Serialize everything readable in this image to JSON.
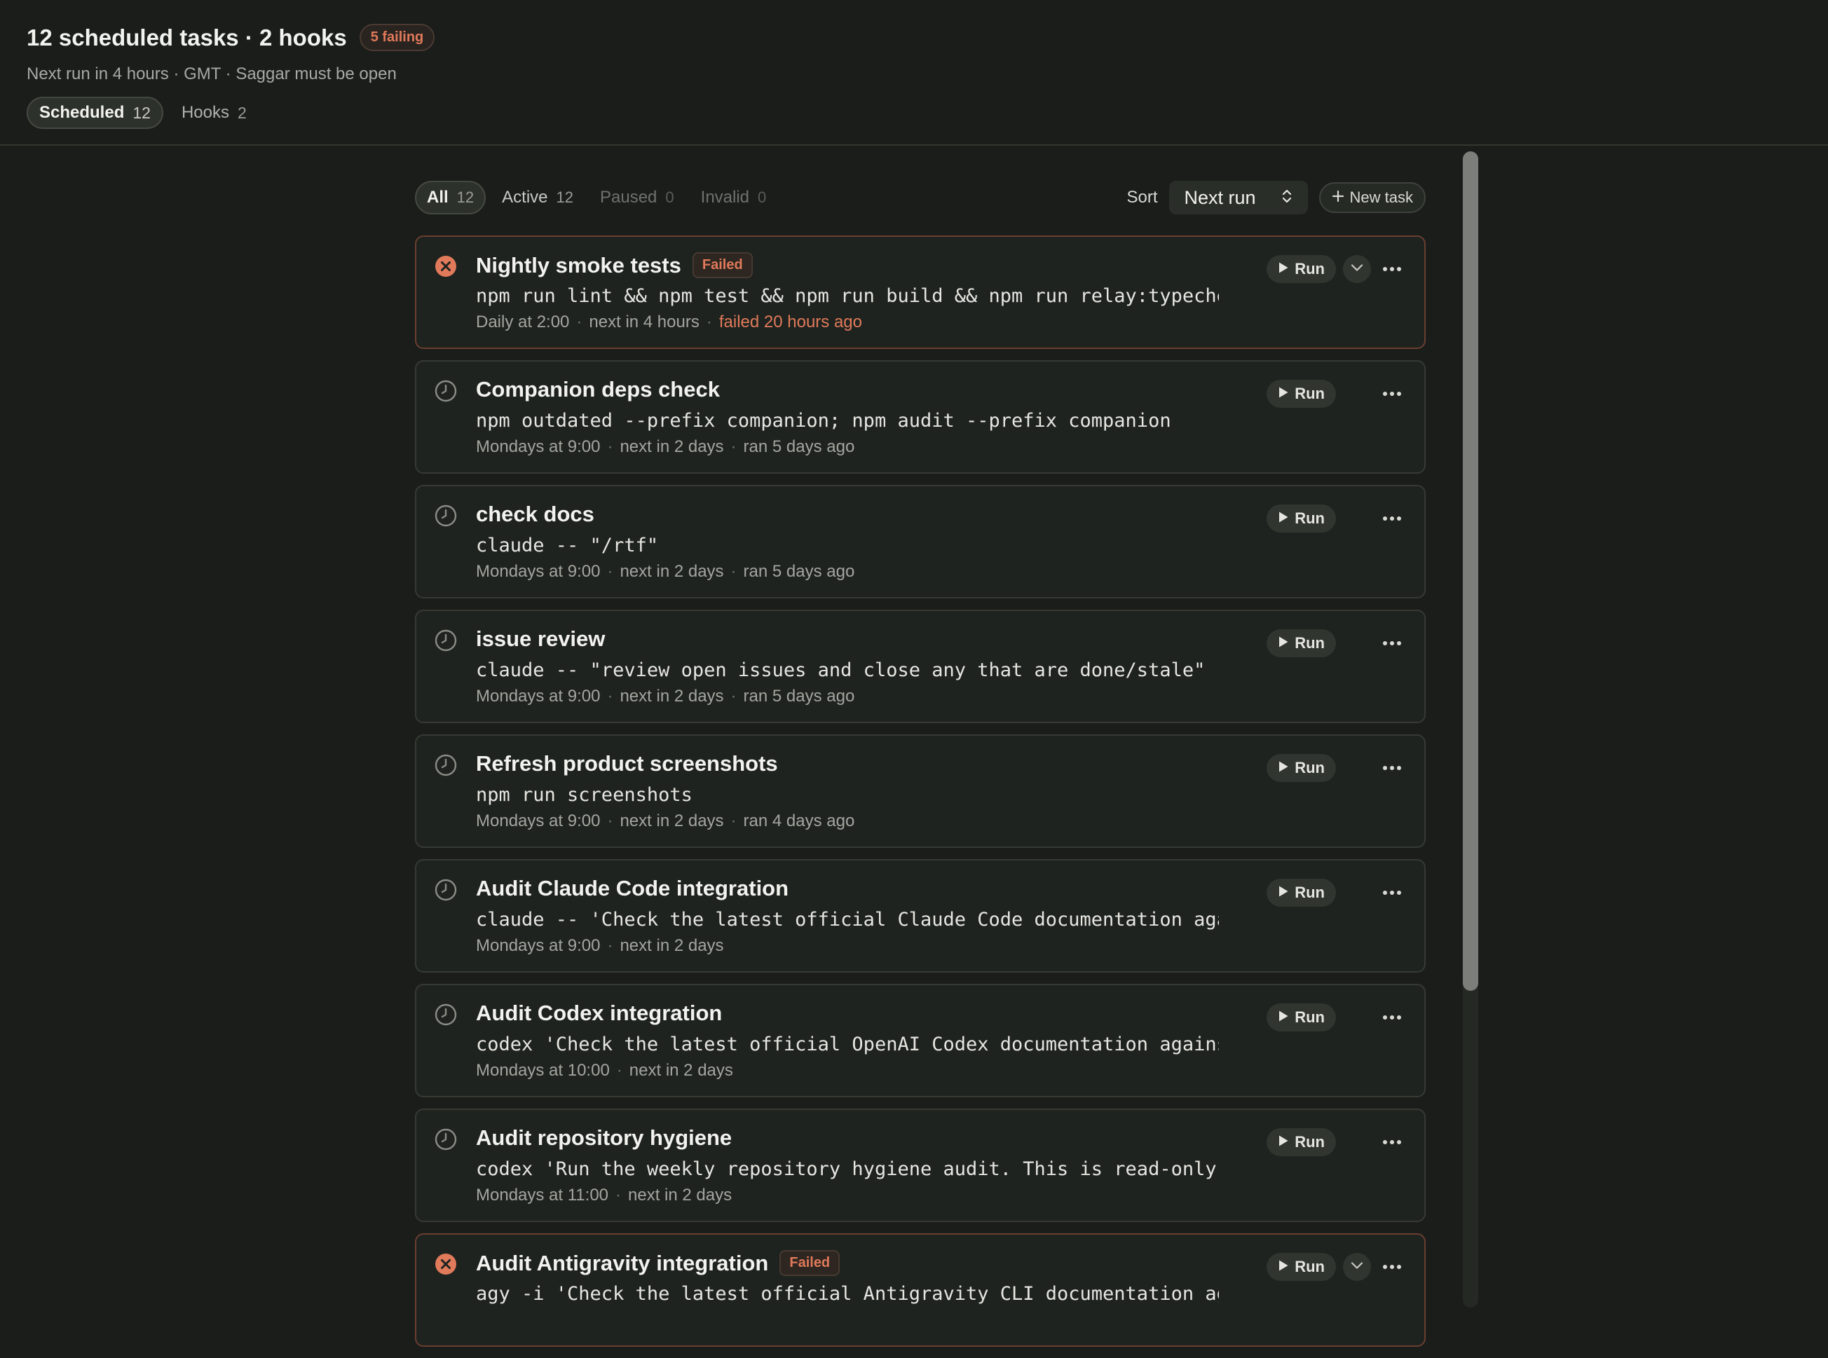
{
  "header": {
    "title": "12 scheduled tasks · 2 hooks",
    "failing_badge": "5 failing",
    "subtitle": "Next run in 4 hours · GMT · Saggar must be open",
    "tabs": [
      {
        "label": "Scheduled",
        "count": "12"
      },
      {
        "label": "Hooks",
        "count": "2"
      }
    ]
  },
  "toolbar": {
    "filters": [
      {
        "label": "All",
        "count": "12"
      },
      {
        "label": "Active",
        "count": "12"
      },
      {
        "label": "Paused",
        "count": "0"
      },
      {
        "label": "Invalid",
        "count": "0"
      }
    ],
    "sort_label": "Sort",
    "sort_value": "Next run",
    "new_task_label": "New task"
  },
  "run_label": "Run",
  "failed_label": "Failed",
  "tasks": [
    {
      "name": "Nightly smoke tests",
      "status": "failed",
      "command": "npm run lint && npm test && npm run build && npm run relay:typechec…",
      "schedule": "Daily at 2:00",
      "next": "next in 4 hours",
      "last": "failed 20 hours ago"
    },
    {
      "name": "Companion deps check",
      "status": "ok",
      "command": "npm outdated --prefix companion; npm audit --prefix companion",
      "schedule": "Mondays at 9:00",
      "next": "next in 2 days",
      "last": "ran 5 days ago"
    },
    {
      "name": "check docs",
      "status": "ok",
      "command": "claude -- \"/rtf\"",
      "schedule": "Mondays at 9:00",
      "next": "next in 2 days",
      "last": "ran 5 days ago"
    },
    {
      "name": "issue review",
      "status": "ok",
      "command": "claude -- \"review open issues and close any that are done/stale\"",
      "schedule": "Mondays at 9:00",
      "next": "next in 2 days",
      "last": "ran 5 days ago"
    },
    {
      "name": "Refresh product screenshots",
      "status": "ok",
      "command": "npm run screenshots",
      "schedule": "Mondays at 9:00",
      "next": "next in 2 days",
      "last": "ran 4 days ago"
    },
    {
      "name": "Audit Claude Code integration",
      "status": "ok",
      "command": "claude -- 'Check the latest official Claude Code documentation agai…",
      "schedule": "Mondays at 9:00",
      "next": "next in 2 days",
      "last": ""
    },
    {
      "name": "Audit Codex integration",
      "status": "ok",
      "command": "codex 'Check the latest official OpenAI Codex documentation against…",
      "schedule": "Mondays at 10:00",
      "next": "next in 2 days",
      "last": ""
    },
    {
      "name": "Audit repository hygiene",
      "status": "ok",
      "command": "codex 'Run the weekly repository hygiene audit. This is read-only:…",
      "schedule": "Mondays at 11:00",
      "next": "next in 2 days",
      "last": ""
    },
    {
      "name": "Audit Antigravity integration",
      "status": "failed",
      "command": "agy -i 'Check the latest official Antigravity CLI documentation aga…",
      "schedule": "",
      "next": "",
      "last": ""
    }
  ]
}
